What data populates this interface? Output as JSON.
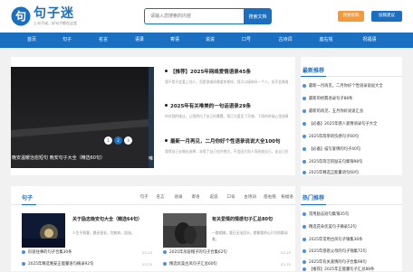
{
  "header": {
    "logo_icon_char": "句",
    "logo_title": "句子迷",
    "logo_subtitle": "上句子迷，好句子都在这里",
    "search_placeholder": "请输入您搜索的内容",
    "search_button": "搜索文档",
    "orange_button": "我要投稿",
    "blue_button": "投稿建议"
  },
  "nav": [
    "首页",
    "句子",
    "名言",
    "语录",
    "寄语",
    "说说",
    "口号",
    "古诗词",
    "座右铭",
    "祝福语"
  ],
  "slider": {
    "caption": "晚安温暖治愈短句 晚安句子大全（精选60句）",
    "next_caption": "唯",
    "dots": [
      "1",
      "2",
      "3"
    ]
  },
  "headlines": [
    {
      "title": "【推荐】2025年网络爱情语录45条",
      "excerpt": "我不是不会爱上别人，而是很难再像爱你那样，我可以接纳另一个人，但不会像曾经爱你那样。"
    },
    {
      "title": "2025年有关唯美的一句话语录29条",
      "excerpt": "你对我的难过，让我明白了自己的愚蠢，我已为爱丢了灵魂。下雨的时候心里放晴，想念你。"
    },
    {
      "title": "最新一月再见，二月你好个性语录说说大全100句",
      "excerpt": "我得自己去做出选择，非得了自己也许地方，不会因为别人而改变自己，走自己的路。"
    }
  ],
  "sidebar1": {
    "title": "最新推荐",
    "items": [
      "最新一月再见，二月你好个性语录说说大全",
      "最新的经典语录句子88条",
      "最新的再见，五月你好说说汇总",
      "【必备】2025年感人爱情语录句子大全",
      "2025年简单的伤感句子60句",
      "【必备】描写爱情的句子40句",
      "2025年简洁的励志句集锦98句",
      "2025年精选正能量语句60句"
    ]
  },
  "bottom": {
    "title": "句子",
    "tags": [
      "句子",
      "名言",
      "语录",
      "寄语",
      "说说",
      "口号",
      "古诗词",
      "座右铭",
      "祝福语"
    ],
    "cards": [
      {
        "title": "关于励志晚安句大全（精选64句）",
        "text": "人生不如意，路还很长，别放弃，加油。"
      },
      {
        "title": "有关爱情的情感句子汇总80句",
        "text": "一路相随，我已无法回头，就像我的心只为你跳动着。"
      }
    ],
    "list_left": [
      {
        "title": "形容往事的句子合集30条",
        "date": "03-25"
      },
      {
        "title": "2025年精选晚安正能量语句摘录92句",
        "date": "03-25"
      }
    ],
    "list_right": [
      {
        "title": "2025年形容帽子的句子合集62句",
        "date": "03-25"
      },
      {
        "title": "精选优美古风句子汇总60句",
        "date": "03-25"
      }
    ]
  },
  "sidebar2": {
    "title": "热门推荐",
    "items": [
      "常用励志短句集锦35句",
      "精选花朵优美句子摘录52句",
      "2025年常用古风句子锦集36条",
      "2025年感恩父母的句子锦集72句",
      "2025年有关爱情的句子合集98句",
      "【推荐】2025年正能量句子汇总88条"
    ]
  },
  "colors": {
    "brand_blue": "#1b6fc0",
    "accent_orange": "#f29a3c"
  }
}
